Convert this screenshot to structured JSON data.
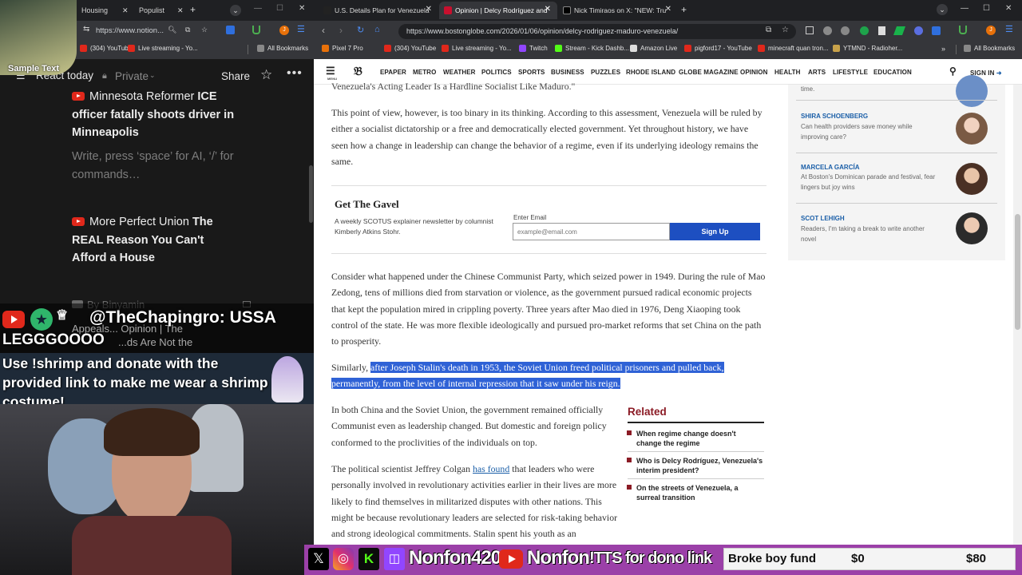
{
  "overlay": {
    "sample": "Sample Text",
    "chat_user": "@TheChapingro: USSA",
    "chat_msg": "LEGGGOOOO",
    "shrimp_banner": "Use !shrimp and donate with the provided link to make me wear a shrimp costume!",
    "socials": [
      "Nonfon420",
      "Nonfon",
      "!TTS for dono link"
    ],
    "goal_label": "Broke boy fund",
    "goal_current": "$0",
    "goal_target": "$80"
  },
  "left_browser": {
    "tabs": [
      "Housing",
      "Populist"
    ],
    "url": "https://www.notion...",
    "bookmarks": [
      "(304) YouTube",
      "Live streaming - Yo...",
      "All Bookmarks"
    ],
    "page_title": "React today",
    "privacy": "Private",
    "share": "Share",
    "items": [
      {
        "channel": "Minnesota Reformer",
        "title": "ICE officer fatally shoots driver in Minneapolis"
      },
      {
        "channel": "More Perfect Union",
        "title": "The REAL Reason You Can't Afford a House"
      }
    ],
    "placeholder": "Write, press ‘space’ for AI, ‘/’ for commands…",
    "byline": "By Binyamin",
    "partial": "Appeals... Opinion | The",
    "partial2": "...ds Are Not the"
  },
  "right_browser": {
    "tabs": [
      {
        "title": "U.S. Details Plan for Venezuela",
        "color": "#222"
      },
      {
        "title": "Opinion | Delcy Rodríguez and",
        "color": "#c8102e"
      },
      {
        "title": "Nick Timiraos on X: \"NEW: Tru",
        "color": "#000"
      }
    ],
    "url": "https://www.bostonglobe.com/2026/01/06/opinion/delcy-rodriguez-maduro-venezuela/",
    "bookmarks": [
      "Pixel 7 Pro",
      "(304) YouTube",
      "Live streaming - Yo...",
      "Twitch",
      "Stream - Kick Dashb...",
      "Amazon Live",
      "pigford17 - YouTube",
      "minecraft quan tron...",
      "YTMND - Radioher...",
      "All Bookmarks"
    ],
    "nav": [
      "EPAPER",
      "METRO",
      "WEATHER",
      "POLITICS",
      "SPORTS",
      "BUSINESS",
      "PUZZLES",
      "RHODE ISLAND",
      "GLOBE MAGAZINE",
      "OPINION",
      "HEALTH",
      "ARTS",
      "LIFESTYLE",
      "EDUCATION"
    ],
    "menu": "MENU",
    "signin": "SIGN IN",
    "article": {
      "top_line": "Venezuela's Acting Leader Is a Hardline Socialist Like Maduro.\"",
      "p1": "This point of view, however, is too binary in its thinking. According to this assessment, Venezuela will be ruled by either a socialist dictatorship or a free and democratically elected government. Yet throughout history, we have seen how a change in leadership can change the behavior of a regime, even if its underlying ideology remains the same.",
      "p2": "Consider what happened under the Chinese Communist Party, which seized power in 1949. During the rule of Mao Zedong, tens of millions died from starvation or violence, as the government pursued radical economic projects that kept the population mired in crippling poverty. Three years after Mao died in 1976, Deng Xiaoping took control of the state. He was more flexible ideologically and pursued pro-market reforms that set China on the path to prosperity.",
      "p3_start": "Similarly,",
      "p3_hl": "after Joseph Stalin's death in 1953, the Soviet Union freed political prisoners and pulled back, permanently, from the level of internal repression that it saw under his reign.",
      "p4": "In both China and the Soviet Union, the government remained officially Communist even as leadership changed. But domestic and foreign policy conformed to the proclivities of the individuals on top.",
      "p5a": "The political scientist Jeffrey Colgan",
      "p5link": "has found",
      "p5b": "that leaders who were personally involved in revolutionary activities earlier in their lives are more likely to find themselves in militarized disputes with other nations. This might be because revolutionary leaders are selected for risk-taking behavior and strong ideological commitments. Stalin spent his youth as an underground opponent of the"
    },
    "newsletter": {
      "title": "Get The Gavel",
      "desc": "A weekly SCOTUS explainer newsletter by columnist Kimberly Atkins Stohr.",
      "email_label": "Enter Email",
      "placeholder": "example@email.com",
      "button": "Sign Up"
    },
    "related": {
      "title": "Related",
      "items": [
        "When regime change doesn't change the regime",
        "Who is Delcy Rodríguez, Venezuela's interim president?",
        "On the streets of Venezuela, a surreal transition"
      ]
    },
    "sidebar": [
      {
        "name": "",
        "desc": "time."
      },
      {
        "name": "SHIRA SCHOENBERG",
        "desc": "Can health providers save money while improving care?"
      },
      {
        "name": "MARCELA GARCÍA",
        "desc": "At Boston's Dominican parade and festival, fear lingers but joy wins"
      },
      {
        "name": "SCOT LEHIGH",
        "desc": "Readers, I'm taking a break to write another novel"
      }
    ]
  }
}
